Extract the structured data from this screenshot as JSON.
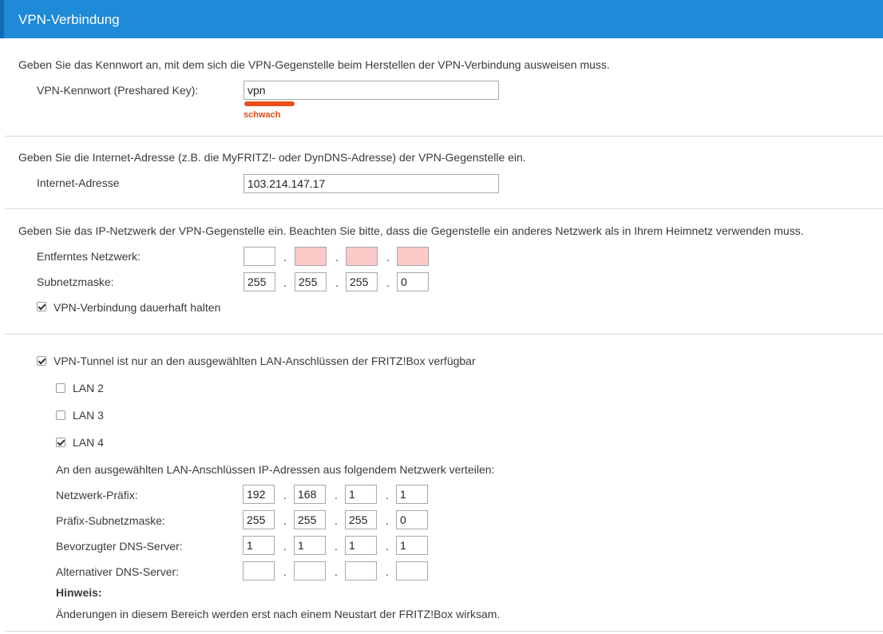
{
  "header": {
    "title": "VPN-Verbindung"
  },
  "key_section": {
    "intro": "Geben Sie das Kennwort an, mit dem sich die VPN-Gegenstelle beim Herstellen der VPN-Verbindung ausweisen muss.",
    "label": "VPN-Kennwort (Preshared Key):",
    "value": "vpn",
    "strength_label": "schwach",
    "strength_level": 0.2
  },
  "address_section": {
    "intro": "Geben Sie die Internet-Adresse (z.B. die MyFRITZ!- oder DynDNS-Adresse) der VPN-Gegenstelle ein.",
    "label": "Internet-Adresse",
    "value": "103.214.147.17"
  },
  "network_section": {
    "intro": "Geben Sie das IP-Netzwerk der VPN-Gegenstelle ein. Beachten Sie bitte, dass die Gegenstelle ein anderes Netzwerk als in Ihrem Heimnetz verwenden muss.",
    "remote_label": "Entferntes Netzwerk:",
    "remote_octets": [
      "",
      "",
      "",
      ""
    ],
    "remote_octets_invalid": [
      false,
      true,
      true,
      true
    ],
    "mask_label": "Subnetzmaske:",
    "mask_octets": [
      "255",
      "255",
      "255",
      "0"
    ],
    "keep_alive_label": "VPN-Verbindung dauerhaft halten",
    "keep_alive_checked": true
  },
  "lan_section": {
    "tunnel_label": "VPN-Tunnel ist nur an den ausgewählten LAN-Anschlüssen der FRITZ!Box verfügbar",
    "tunnel_checked": true,
    "ports": [
      {
        "label": "LAN 2",
        "checked": false
      },
      {
        "label": "LAN 3",
        "checked": false
      },
      {
        "label": "LAN 4",
        "checked": true
      }
    ],
    "distribute_text": "An den ausgewählten LAN-Anschlüssen IP-Adressen aus folgendem Netzwerk verteilen:",
    "prefix_label": "Netzwerk-Präfix:",
    "prefix_octets": [
      "192",
      "168",
      "1",
      "1"
    ],
    "prefix_mask_label": "Präfix-Subnetzmaske:",
    "prefix_mask_octets": [
      "255",
      "255",
      "255",
      "0"
    ],
    "dns_pref_label": "Bevorzugter DNS-Server:",
    "dns_pref_octets": [
      "1",
      "1",
      "1",
      "1"
    ],
    "dns_alt_label": "Alternativer DNS-Server:",
    "dns_alt_octets": [
      "",
      "",
      "",
      ""
    ],
    "hint_title": "Hinweis:",
    "hint_text": "Änderungen in diesem Bereich werden erst nach einem Neustart der FRITZ!Box wirksam."
  },
  "colors": {
    "header": "#1f8ad8",
    "strength_weak": "#e94e1b",
    "invalid_field": "#fcc9c9"
  }
}
